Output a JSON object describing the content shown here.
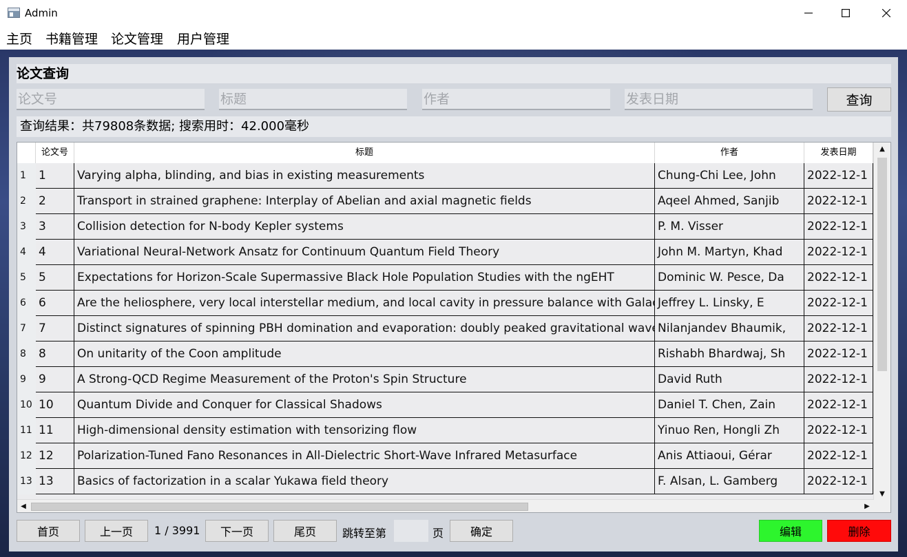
{
  "window": {
    "title": "Admin",
    "minimize": "—",
    "maximize": "☐",
    "close": "✕"
  },
  "menu": {
    "items": [
      "主页",
      "书籍管理",
      "论文管理",
      "用户管理"
    ]
  },
  "section": {
    "title": "论文查询"
  },
  "search": {
    "paper_id_placeholder": "论文号",
    "title_placeholder": "标题",
    "author_placeholder": "作者",
    "date_placeholder": "发表日期",
    "query_label": "查询"
  },
  "result": {
    "text": "查询结果：共79808条数据; 搜索用时：42.000毫秒"
  },
  "table": {
    "columns": [
      "论文号",
      "标题",
      "作者",
      "发表日期"
    ],
    "rows": [
      {
        "n": "1",
        "id": "1",
        "title": "Varying alpha, blinding, and bias in existing measurements",
        "author": "Chung-Chi Lee, John",
        "date": "2022-12-1"
      },
      {
        "n": "2",
        "id": "2",
        "title": "Transport in strained graphene: Interplay of Abelian and axial magnetic fields",
        "author": "Aqeel Ahmed, Sanjib",
        "date": "2022-12-1"
      },
      {
        "n": "3",
        "id": "3",
        "title": "Collision detection for N-body Kepler systems",
        "author": "P. M. Visser",
        "date": "2022-12-1"
      },
      {
        "n": "4",
        "id": "4",
        "title": "Variational Neural-Network Ansatz for Continuum Quantum Field Theory",
        "author": "John M. Martyn, Khad",
        "date": "2022-12-1"
      },
      {
        "n": "5",
        "id": "5",
        "title": "Expectations for Horizon-Scale Supermassive Black Hole Population Studies with the ngEHT",
        "author": "Dominic W. Pesce, Da",
        "date": "2022-12-1"
      },
      {
        "n": "6",
        "id": "6",
        "title": "Are the heliosphere, very local interstellar medium, and local cavity in pressure balance with Galac",
        "author": "Jeffrey L. Linsky, E",
        "date": "2022-12-1"
      },
      {
        "n": "7",
        "id": "7",
        "title": "Distinct signatures of spinning PBH domination and evaporation: doubly peaked gravitational waves, d",
        "author": "Nilanjandev Bhaumik,",
        "date": "2022-12-1"
      },
      {
        "n": "8",
        "id": "8",
        "title": "On unitarity of the Coon amplitude",
        "author": "Rishabh Bhardwaj, Sh",
        "date": "2022-12-1"
      },
      {
        "n": "9",
        "id": "9",
        "title": "A Strong-QCD Regime Measurement of the Proton's Spin Structure",
        "author": "David Ruth",
        "date": "2022-12-1"
      },
      {
        "n": "10",
        "id": "10",
        "title": "Quantum Divide and Conquer for Classical Shadows",
        "author": "Daniel T. Chen, Zain",
        "date": "2022-12-1"
      },
      {
        "n": "11",
        "id": "11",
        "title": "High-dimensional density estimation with tensorizing flow",
        "author": "Yinuo Ren, Hongli Zh",
        "date": "2022-12-1"
      },
      {
        "n": "12",
        "id": "12",
        "title": "Polarization-Tuned Fano Resonances in All-Dielectric Short-Wave Infrared Metasurface",
        "author": "Anis Attiaoui, Gérar",
        "date": "2022-12-1"
      },
      {
        "n": "13",
        "id": "13",
        "title": "Basics of factorization in a scalar Yukawa field theory",
        "author": "F. Alsan, L. Gamberg",
        "date": "2022-12-1"
      }
    ]
  },
  "pager": {
    "first": "首页",
    "prev": "上一页",
    "page_info": "1 / 3991",
    "next": "下一页",
    "last": "尾页",
    "jump_to": "跳转至第",
    "page_unit": "页",
    "confirm": "确定",
    "jump_value": ""
  },
  "actions": {
    "edit": "编辑",
    "delete": "删除"
  },
  "colors": {
    "edit": "#2df52d",
    "delete": "#ff0a0a"
  }
}
